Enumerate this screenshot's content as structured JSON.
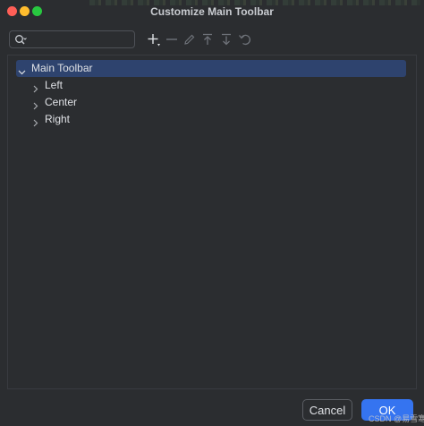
{
  "window": {
    "title": "Customize Main Toolbar"
  },
  "search": {
    "value": "",
    "placeholder": ""
  },
  "toolbar": {
    "icons": [
      "add-icon",
      "remove-icon",
      "edit-icon",
      "move-up-icon",
      "move-down-icon",
      "restore-icon"
    ]
  },
  "tree": {
    "root": {
      "label": "Main Toolbar",
      "expanded": true,
      "selected": true
    },
    "children": [
      {
        "label": "Left",
        "expanded": false
      },
      {
        "label": "Center",
        "expanded": false
      },
      {
        "label": "Right",
        "expanded": false
      }
    ]
  },
  "buttons": {
    "cancel": "Cancel",
    "ok": "OK"
  },
  "watermark": "CSDN @易雪寒",
  "colors": {
    "background": "#2b2d30",
    "selection": "#2e436e",
    "accent": "#3574f0",
    "close": "#ff5f57",
    "minimize": "#febc2e",
    "maximize": "#28c840"
  }
}
